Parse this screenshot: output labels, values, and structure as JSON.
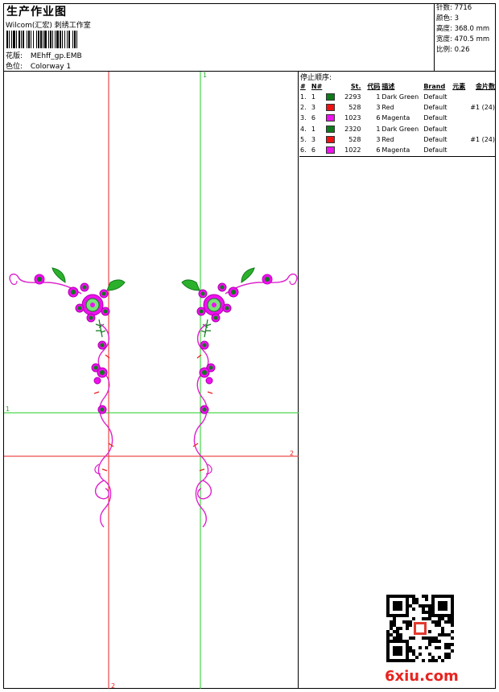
{
  "header": {
    "title": "生产作业图",
    "subtitle": "Wilcom(汇宏) 刺绣工作室",
    "pattern_label": "花版:",
    "pattern_value": "MEhff_gp.EMB",
    "color_label": "色位:",
    "color_value": "Colorway 1"
  },
  "stats": {
    "stitches": "针数: 7716",
    "colors": "颜色: 3",
    "height": "高度: 368.0 mm",
    "width": "宽度: 470.5 mm",
    "scale": "比例: 0.26"
  },
  "stop_sequence": {
    "title": "停止顺序:",
    "columns": [
      "#",
      "N#",
      "St.",
      "代码",
      "描述",
      "Brand",
      "元素",
      "金片数"
    ],
    "rows": [
      {
        "idx": "1.",
        "n": "1",
        "color": "#0f7a1c",
        "st": "2293",
        "code": "1",
        "desc": "Dark Green",
        "brand": "Default",
        "elem": "",
        "seq": ""
      },
      {
        "idx": "2.",
        "n": "3",
        "color": "#ee1111",
        "st": "528",
        "code": "3",
        "desc": "Red",
        "brand": "Default",
        "elem": "",
        "seq": "#1 (24)"
      },
      {
        "idx": "3.",
        "n": "6",
        "color": "#ee11ee",
        "st": "1023",
        "code": "6",
        "desc": "Magenta",
        "brand": "Default",
        "elem": "",
        "seq": ""
      },
      {
        "idx": "4.",
        "n": "1",
        "color": "#0f7a1c",
        "st": "2320",
        "code": "1",
        "desc": "Dark Green",
        "brand": "Default",
        "elem": "",
        "seq": ""
      },
      {
        "idx": "5.",
        "n": "3",
        "color": "#ee1111",
        "st": "528",
        "code": "3",
        "desc": "Red",
        "brand": "Default",
        "elem": "",
        "seq": "#1 (24)"
      },
      {
        "idx": "6.",
        "n": "6",
        "color": "#ee11ee",
        "st": "1022",
        "code": "6",
        "desc": "Magenta",
        "brand": "Default",
        "elem": "",
        "seq": ""
      }
    ]
  },
  "guides": {
    "vertical_green_top": "1",
    "vertical_red_bottom": "2",
    "horizontal_green_left": "1",
    "horizontal_red_right": "2"
  },
  "watermark": "6xiu.com"
}
